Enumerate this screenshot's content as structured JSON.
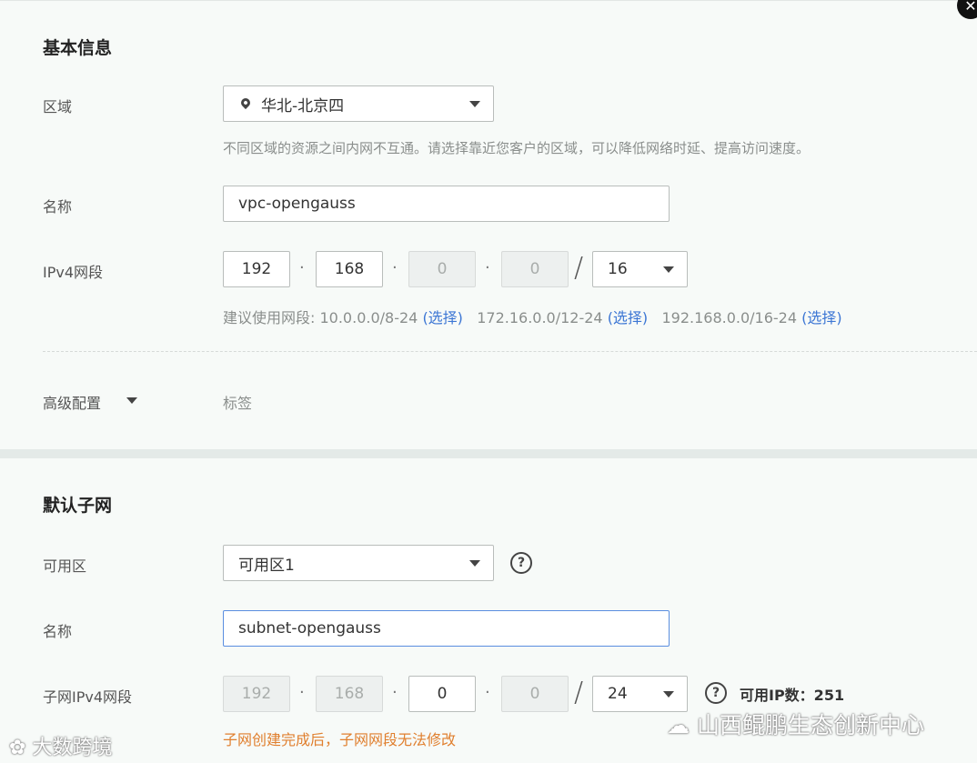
{
  "basic": {
    "title": "基本信息",
    "region": {
      "label": "区域",
      "value": "华北-北京四",
      "hint": "不同区域的资源之间内网不互通。请选择靠近您客户的区域，可以降低网络时延、提高访问速度。"
    },
    "name": {
      "label": "名称",
      "value": "vpc-opengauss"
    },
    "ipv4": {
      "label": "IPv4网段",
      "octets": [
        "192",
        "168",
        "0",
        "0"
      ],
      "dot": "·",
      "slash": "/",
      "mask": "16",
      "hint_prefix": "建议使用网段: ",
      "suggestions": [
        {
          "range": "10.0.0.0/8-24 ",
          "select": "(选择)"
        },
        {
          "range": "172.16.0.0/12-24 ",
          "select": "(选择)"
        },
        {
          "range": "192.168.0.0/16-24 ",
          "select": "(选择)"
        }
      ]
    },
    "advanced": {
      "label": "高级配置",
      "value": "标签"
    }
  },
  "subnet": {
    "title": "默认子网",
    "az": {
      "label": "可用区",
      "value": "可用区1",
      "help": "?"
    },
    "name": {
      "label": "名称",
      "value": "subnet-opengauss"
    },
    "ipv4": {
      "label": "子网IPv4网段",
      "octets": [
        "192",
        "168",
        "0",
        "0"
      ],
      "mask": "24",
      "help": "?",
      "available": "可用IP数：251",
      "warning": "子网创建完成后，子网网段无法修改"
    }
  },
  "watermarks": {
    "left": "大数跨境",
    "right": "山西鲲鹏生态创新中心"
  },
  "close_symbol": "✕"
}
